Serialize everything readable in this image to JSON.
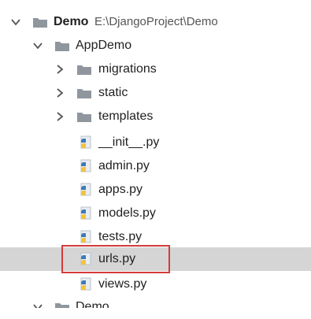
{
  "project": {
    "name": "Demo",
    "path": "E:\\DjangoProject\\Demo"
  },
  "app_folder": "AppDemo",
  "subfolders": [
    "migrations",
    "static",
    "templates"
  ],
  "files": [
    "__init__.py",
    "admin.py",
    "apps.py",
    "models.py",
    "tests.py",
    "urls.py",
    "views.py"
  ],
  "selected_file": "urls.py",
  "bottom_partial": "Demo",
  "colors": {
    "selected_row": "#d5d5d5",
    "highlight_border": "#d63a3a",
    "folder": "#8f969e",
    "python_blue": "#3d7ab8",
    "python_yellow": "#f2c33c"
  }
}
